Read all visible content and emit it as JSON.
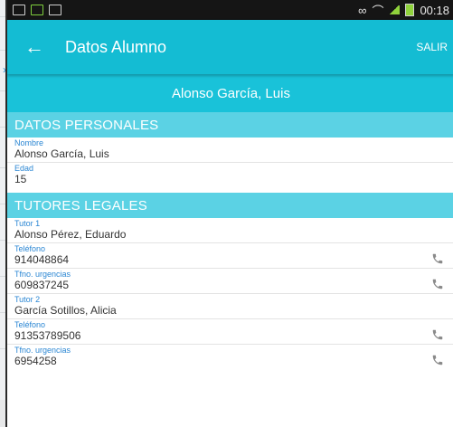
{
  "app": {
    "statusbar": {
      "time": "00:18"
    },
    "appbar": {
      "back_icon": "arrow-left-icon",
      "title": "Datos Alumno",
      "action": "SALIR"
    },
    "student_name": "Alonso García, Luis",
    "personal": {
      "header": "DATOS PERSONALES",
      "fields": [
        {
          "label": "Nombre",
          "value": "Alonso García, Luis"
        },
        {
          "label": "Edad",
          "value": "15"
        }
      ]
    },
    "tutors": {
      "header": "TUTORES LEGALES",
      "entries": [
        {
          "label": "Tutor 1",
          "value": "Alonso Pérez, Eduardo"
        },
        {
          "label": "Teléfono",
          "value": "914048864",
          "icon": "phone-icon"
        },
        {
          "label": "Tfno. urgencias",
          "value": "609837245",
          "icon": "phone-icon"
        },
        {
          "label": "Tutor 2",
          "value": "García Sotillos, Alicia"
        },
        {
          "label": "Teléfono",
          "value": "91353789506",
          "icon": "phone-icon"
        },
        {
          "label": "Tfno. urgencias",
          "value": "6954258",
          "icon": "phone-icon"
        }
      ]
    }
  },
  "colors": {
    "appbar": "#14bcd3",
    "section": "#5bd2e4",
    "label": "#2a86d3",
    "phone_icon": "#8a8a8a"
  }
}
